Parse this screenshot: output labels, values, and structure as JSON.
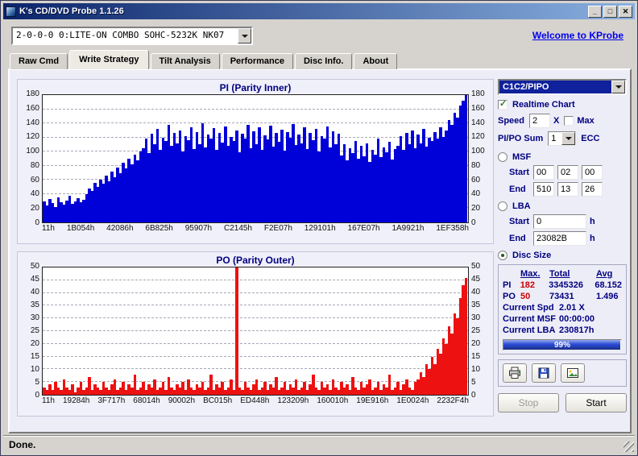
{
  "window": {
    "title": "K's CD/DVD Probe 1.1.26",
    "status": "Done."
  },
  "colors": {
    "titlebar_left": "#0a246a",
    "titlebar_right": "#8ab0e0",
    "selection_bg": "#10219c",
    "link": "#0000ee",
    "progress_fill": "#2a4bd7"
  },
  "header": {
    "drive": "2-0-0-0 0:LITE-ON COMBO SOHC-5232K NK07",
    "welcome_link": "Welcome to KProbe"
  },
  "tabs": [
    {
      "label": "Raw Cmd"
    },
    {
      "label": "Write Strategy"
    },
    {
      "label": "Tilt Analysis"
    },
    {
      "label": "Performance"
    },
    {
      "label": "Disc Info."
    },
    {
      "label": "About"
    }
  ],
  "active_tab": "Write Strategy",
  "panel": {
    "mode_combo": "C1C2/PIPO",
    "realtime": {
      "label": "Realtime Chart",
      "checked": true
    },
    "speed": {
      "label": "Speed",
      "value": "2",
      "unit": "X",
      "max_label": "Max",
      "max_checked": false
    },
    "sum": {
      "label": "PI/PO Sum",
      "value": "1",
      "unit": "ECC"
    },
    "msf": {
      "label": "MSF",
      "selected": false,
      "start_label": "Start",
      "end_label": "End",
      "start": [
        "00",
        "02",
        "00"
      ],
      "end": [
        "510",
        "13",
        "26"
      ]
    },
    "lba": {
      "label": "LBA",
      "selected": false,
      "start_label": "Start",
      "end_label": "End",
      "start": "0",
      "end": "23082B",
      "unit": "h"
    },
    "disc_size": {
      "label": "Disc Size",
      "selected": true
    },
    "stats": {
      "headers": [
        "Max.",
        "Total",
        "Avg"
      ],
      "pi": {
        "label": "PI",
        "max": "182",
        "total": "3345326",
        "avg": "68.152"
      },
      "po": {
        "label": "PO",
        "max": "50",
        "total": "73431",
        "avg": "1.496"
      }
    },
    "current": {
      "spd": {
        "label": "Current Spd",
        "value": "2.01 X"
      },
      "msf": {
        "label": "Current MSF",
        "value": "00:00:00"
      },
      "lba": {
        "label": "Current LBA",
        "value": "230817h"
      }
    },
    "progress": {
      "percent": 99,
      "label": "99%"
    },
    "actions": {
      "stop": "Stop",
      "start": "Start"
    }
  },
  "icons": [
    "printer-icon",
    "floppy-save-icon",
    "export-image-icon",
    "minimize-icon",
    "maximize-icon",
    "close-icon",
    "dropdown-arrow-icon"
  ],
  "chart_data": [
    {
      "type": "bar",
      "title": "PI (Parity Inner)",
      "color": "#0000d8",
      "ylim": [
        0,
        180
      ],
      "yticks": [
        0,
        20,
        40,
        60,
        80,
        100,
        120,
        140,
        160,
        180
      ],
      "x_tick_labels": [
        "11h",
        "1B054h",
        "42086h",
        "6B825h",
        "95907h",
        "C2145h",
        "F2E07h",
        "129101h",
        "167E07h",
        "1A9921h",
        "1EF358h"
      ],
      "values": [
        30,
        24,
        33,
        27,
        22,
        35,
        29,
        25,
        31,
        38,
        26,
        30,
        34,
        28,
        32,
        40,
        48,
        44,
        56,
        50,
        60,
        55,
        66,
        58,
        72,
        64,
        78,
        70,
        84,
        76,
        90,
        82,
        96,
        88,
        100,
        105,
        118,
        98,
        125,
        110,
        132,
        102,
        120,
        115,
        138,
        108,
        126,
        112,
        130,
        100,
        122,
        116,
        135,
        104,
        128,
        110,
        140,
        106,
        124,
        118,
        133,
        102,
        127,
        113,
        136,
        108,
        121,
        115,
        130,
        99,
        125,
        119,
        138,
        105,
        129,
        111,
        134,
        103,
        123,
        117,
        137,
        107,
        126,
        114,
        131,
        101,
        128,
        120,
        139,
        109,
        124,
        112,
        135,
        104,
        127,
        116,
        132,
        100,
        122,
        118,
        136,
        106,
        129,
        110,
        125,
        95,
        110,
        88,
        105,
        98,
        115,
        90,
        108,
        94,
        112,
        86,
        102,
        96,
        118,
        92,
        106,
        99,
        114,
        89,
        104,
        108,
        122,
        102,
        126,
        110,
        130,
        105,
        124,
        112,
        132,
        107,
        120,
        115,
        128,
        118,
        134,
        121,
        130,
        145,
        138,
        155,
        148,
        165,
        172,
        180
      ]
    },
    {
      "type": "bar",
      "title": "PO (Parity Outer)",
      "color": "#ee1111",
      "ylim": [
        0,
        50
      ],
      "yticks": [
        0,
        5,
        10,
        15,
        20,
        25,
        30,
        35,
        40,
        45,
        50
      ],
      "x_tick_labels": [
        "11h",
        "19284h",
        "3F717h",
        "68014h",
        "90002h",
        "BC015h",
        "ED448h",
        "123209h",
        "160010h",
        "19E916h",
        "1E0024h",
        "2232F4h"
      ],
      "values": [
        3,
        2,
        4,
        2,
        5,
        3,
        2,
        6,
        3,
        2,
        4,
        1,
        3,
        5,
        2,
        3,
        7,
        2,
        4,
        3,
        2,
        5,
        3,
        2,
        4,
        6,
        2,
        3,
        5,
        2,
        4,
        3,
        8,
        2,
        3,
        5,
        2,
        4,
        3,
        6,
        2,
        3,
        5,
        2,
        7,
        3,
        2,
        4,
        3,
        5,
        2,
        6,
        3,
        2,
        4,
        3,
        5,
        2,
        3,
        8,
        2,
        4,
        3,
        5,
        2,
        3,
        6,
        2,
        50,
        3,
        2,
        5,
        3,
        2,
        4,
        6,
        2,
        3,
        5,
        2,
        4,
        3,
        7,
        2,
        3,
        5,
        2,
        4,
        3,
        6,
        2,
        3,
        5,
        2,
        4,
        8,
        3,
        2,
        5,
        3,
        4,
        2,
        6,
        3,
        2,
        5,
        3,
        4,
        2,
        7,
        3,
        2,
        5,
        3,
        4,
        6,
        2,
        3,
        5,
        2,
        4,
        3,
        8,
        2,
        3,
        5,
        2,
        4,
        6,
        3,
        2,
        5,
        6,
        9,
        7,
        12,
        10,
        15,
        12,
        18,
        16,
        22,
        20,
        27,
        24,
        32,
        30,
        38,
        43,
        46
      ]
    }
  ]
}
